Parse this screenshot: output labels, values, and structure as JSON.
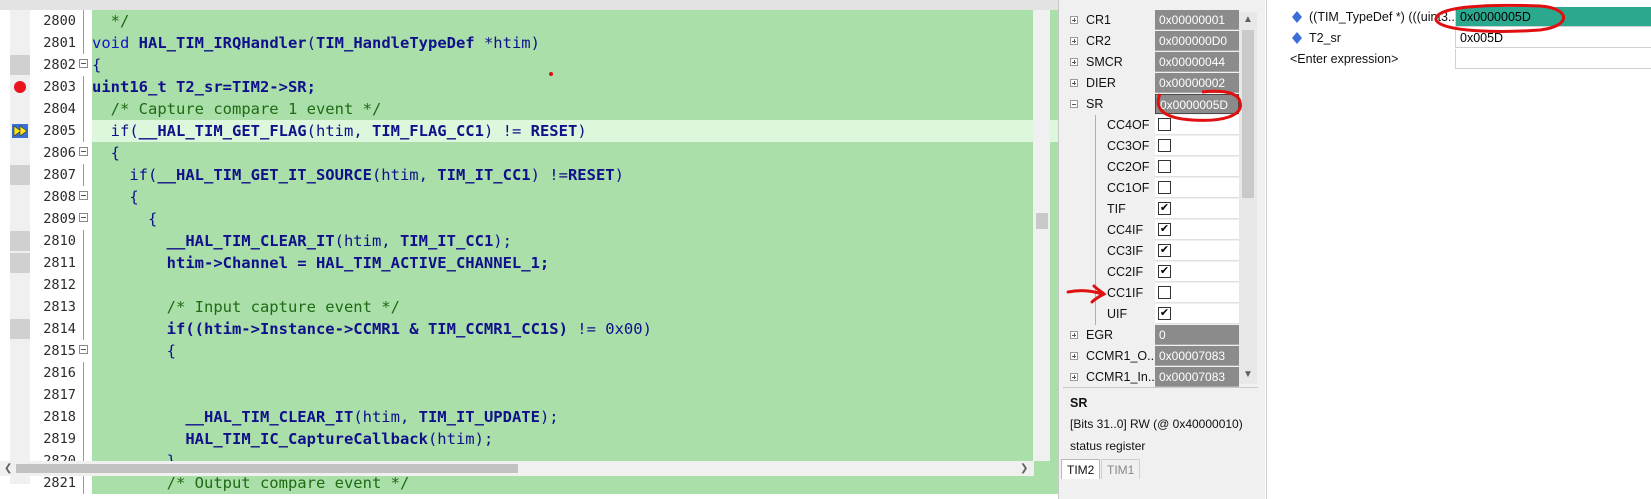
{
  "editor": {
    "lines": [
      {
        "num": "2800",
        "indent": "  ",
        "tokens": [
          {
            "t": "*/",
            "k": "cm"
          }
        ]
      },
      {
        "num": "2801",
        "indent": "",
        "tokens": [
          {
            "t": "void ",
            "k": "kw"
          },
          {
            "t": "HAL_TIM_IRQHandler",
            "k": "fn"
          },
          {
            "t": "(",
            "k": "pl"
          },
          {
            "t": "TIM_HandleTypeDef",
            "k": "fn"
          },
          {
            "t": " *htim)",
            "k": "pl"
          }
        ]
      },
      {
        "num": "2802",
        "indent": "",
        "tokens": [
          {
            "t": "{",
            "k": "pl"
          }
        ]
      },
      {
        "num": "2803",
        "indent": "",
        "tokens": [
          {
            "t": "uint16_t T2_sr=TIM2->SR;",
            "k": "fn"
          }
        ]
      },
      {
        "num": "2804",
        "indent": "  ",
        "tokens": [
          {
            "t": "/* Capture compare 1 event */",
            "k": "cm"
          }
        ]
      },
      {
        "num": "2805",
        "indent": "  ",
        "tokens": [
          {
            "t": "if(",
            "k": "pl"
          },
          {
            "t": "__HAL_TIM_GET_FLAG",
            "k": "fn"
          },
          {
            "t": "(htim, ",
            "k": "pl"
          },
          {
            "t": "TIM_FLAG_CC1",
            "k": "fn"
          },
          {
            "t": ") != ",
            "k": "pl"
          },
          {
            "t": "RESET",
            "k": "fn"
          },
          {
            "t": ")",
            "k": "pl"
          }
        ]
      },
      {
        "num": "2806",
        "indent": "  ",
        "tokens": [
          {
            "t": "{",
            "k": "pl"
          }
        ]
      },
      {
        "num": "2807",
        "indent": "    ",
        "tokens": [
          {
            "t": "if(",
            "k": "pl"
          },
          {
            "t": "__HAL_TIM_GET_IT_SOURCE",
            "k": "fn"
          },
          {
            "t": "(htim, ",
            "k": "pl"
          },
          {
            "t": "TIM_IT_CC1",
            "k": "fn"
          },
          {
            "t": ") !=",
            "k": "pl"
          },
          {
            "t": "RESET",
            "k": "fn"
          },
          {
            "t": ")",
            "k": "pl"
          }
        ]
      },
      {
        "num": "2808",
        "indent": "    ",
        "tokens": [
          {
            "t": "{",
            "k": "pl"
          }
        ]
      },
      {
        "num": "2809",
        "indent": "      ",
        "tokens": [
          {
            "t": "{",
            "k": "pl"
          }
        ]
      },
      {
        "num": "2810",
        "indent": "        ",
        "tokens": [
          {
            "t": "__HAL_TIM_CLEAR_IT",
            "k": "fn"
          },
          {
            "t": "(htim, ",
            "k": "pl"
          },
          {
            "t": "TIM_IT_CC1",
            "k": "fn"
          },
          {
            "t": ");",
            "k": "pl"
          }
        ]
      },
      {
        "num": "2811",
        "indent": "        ",
        "tokens": [
          {
            "t": "htim->Channel = HAL_TIM_ACTIVE_CHANNEL_1;",
            "k": "fn"
          }
        ]
      },
      {
        "num": "2812",
        "indent": "",
        "tokens": []
      },
      {
        "num": "2813",
        "indent": "        ",
        "tokens": [
          {
            "t": "/* Input capture event */",
            "k": "cm"
          }
        ]
      },
      {
        "num": "2814",
        "indent": "        ",
        "tokens": [
          {
            "t": "if((htim->Instance->CCMR1 & TIM_CCMR1_CC1S)",
            "k": "fn"
          },
          {
            "t": " != ",
            "k": "pl"
          },
          {
            "t": "0x00",
            "k": "pl"
          },
          {
            "t": ")",
            "k": "pl"
          }
        ]
      },
      {
        "num": "2815",
        "indent": "        ",
        "tokens": [
          {
            "t": "{",
            "k": "pl"
          }
        ]
      },
      {
        "num": "2816",
        "indent": "",
        "tokens": []
      },
      {
        "num": "2817",
        "indent": "",
        "tokens": []
      },
      {
        "num": "2818",
        "indent": "          ",
        "tokens": [
          {
            "t": "__HAL_TIM_CLEAR_IT",
            "k": "fn"
          },
          {
            "t": "(htim, ",
            "k": "pl"
          },
          {
            "t": "TIM_IT_UPDATE",
            "k": "fn"
          },
          {
            "t": ");",
            "k": "pl"
          }
        ]
      },
      {
        "num": "2819",
        "indent": "          ",
        "tokens": [
          {
            "t": "HAL_TIM_IC_CaptureCallback",
            "k": "fn"
          },
          {
            "t": "(htim);",
            "k": "pl"
          }
        ]
      },
      {
        "num": "2820",
        "indent": "        ",
        "tokens": [
          {
            "t": "}",
            "k": "pl"
          }
        ]
      },
      {
        "num": "2821",
        "indent": "        ",
        "tokens": [
          {
            "t": "/* Output compare event */",
            "k": "cm"
          }
        ]
      }
    ],
    "breakpoint_line": "2803",
    "current_line": "2805",
    "fold_lines": [
      "2802",
      "2806",
      "2808",
      "2809",
      "2815"
    ],
    "marked_lines": [
      "2802",
      "2807",
      "2810",
      "2811",
      "2814"
    ]
  },
  "registers": {
    "rows": [
      {
        "name": "CR1",
        "value": "0x00000001",
        "type": "reg",
        "expand": "plus"
      },
      {
        "name": "CR2",
        "value": "0x000000D0",
        "type": "reg",
        "expand": "plus"
      },
      {
        "name": "SMCR",
        "value": "0x00000044",
        "type": "reg",
        "expand": "plus"
      },
      {
        "name": "DIER",
        "value": "0x00000002",
        "type": "reg",
        "expand": "plus"
      },
      {
        "name": "SR",
        "value": "0x0000005D",
        "type": "reg",
        "expand": "minus",
        "selected": true
      },
      {
        "name": "CC4OF",
        "checked": false,
        "type": "bit"
      },
      {
        "name": "CC3OF",
        "checked": false,
        "type": "bit"
      },
      {
        "name": "CC2OF",
        "checked": false,
        "type": "bit"
      },
      {
        "name": "CC1OF",
        "checked": false,
        "type": "bit"
      },
      {
        "name": "TIF",
        "checked": true,
        "type": "bit"
      },
      {
        "name": "CC4IF",
        "checked": true,
        "type": "bit"
      },
      {
        "name": "CC3IF",
        "checked": true,
        "type": "bit"
      },
      {
        "name": "CC2IF",
        "checked": true,
        "type": "bit"
      },
      {
        "name": "CC1IF",
        "checked": false,
        "type": "bit"
      },
      {
        "name": "UIF",
        "checked": true,
        "type": "bit"
      },
      {
        "name": "EGR",
        "value": "0",
        "type": "reg",
        "expand": "plus"
      },
      {
        "name": "CCMR1_O...",
        "value": "0x00007083",
        "type": "reg",
        "expand": "plus"
      },
      {
        "name": "CCMR1_In...",
        "value": "0x00007083",
        "type": "reg",
        "expand": "plus"
      }
    ],
    "info": {
      "name": "SR",
      "bits": "[Bits 31..0] RW (@ 0x40000010)",
      "description": "status register"
    },
    "tabs": [
      "TIM2",
      "TIM1"
    ]
  },
  "watch": {
    "rows": [
      {
        "expr": "((TIM_TypeDef *) (((uint3...",
        "value": "0x0000005D",
        "highlight": true
      },
      {
        "expr": "T2_sr",
        "value": "0x005D",
        "highlight": false
      },
      {
        "expr": "<Enter expression>",
        "value": "",
        "highlight": false
      }
    ]
  },
  "colors": {
    "code_bg": "#aadfaa",
    "current_line_bg": "#ddf7dd",
    "reg_value_bg": "#8b8b8b",
    "watch_highlight_bg": "#2aa98f",
    "annotation": "#e01010"
  }
}
